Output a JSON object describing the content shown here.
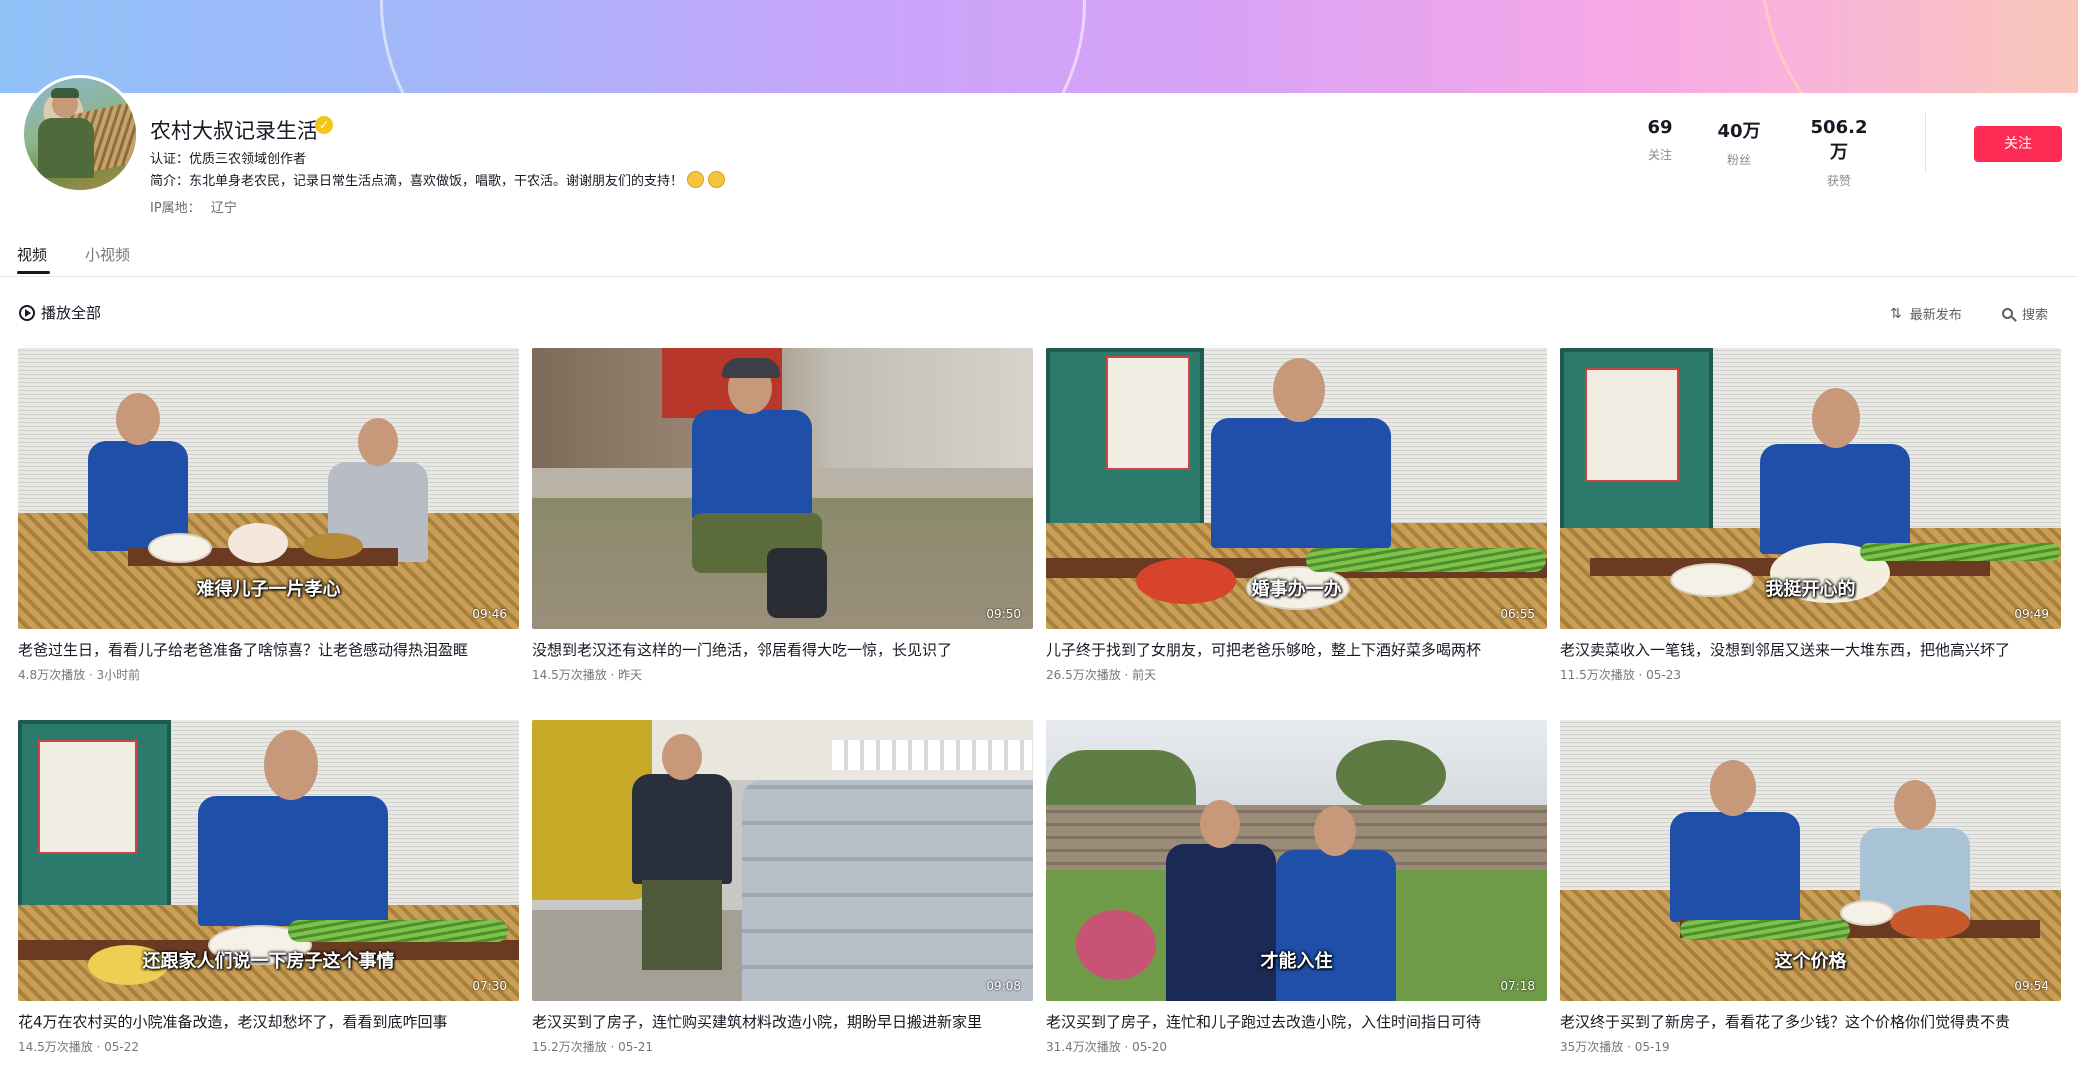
{
  "profile": {
    "name": "农村大叔记录生活",
    "verified_icon": "verified-badge-icon",
    "certification": "认证：优质三农领域创作者",
    "bio": "简介：东北单身老农民，记录日常生活点滴，喜欢做饭，唱歌，干农活。谢谢朋友们的支持！",
    "ip_label": "IP属地：",
    "ip_value": "辽宁",
    "stats": [
      {
        "value": "69",
        "label": "关注"
      },
      {
        "value": "40万",
        "label": "粉丝"
      },
      {
        "value": "506.2万",
        "label": "获赞"
      }
    ],
    "follow_label": "关注"
  },
  "tabs": [
    {
      "label": "视频",
      "active": true
    },
    {
      "label": "小视频",
      "active": false
    }
  ],
  "toolbar": {
    "play_all": "播放全部",
    "sort": "最新发布",
    "search": "搜索"
  },
  "videos": [
    {
      "caption": "难得儿子一片孝心",
      "duration": "09:46",
      "title": "老爸过生日，看看儿子给老爸准备了啥惊喜？让老爸感动得热泪盈眶",
      "meta": "4.8万次播放 · 3小时前"
    },
    {
      "caption": "",
      "duration": "09:50",
      "title": "没想到老汉还有这样的一门绝活，邻居看得大吃一惊，长见识了",
      "meta": "14.5万次播放 · 昨天"
    },
    {
      "caption": "婚事办一办",
      "duration": "06:55",
      "title": "儿子终于找到了女朋友，可把老爸乐够呛，整上下酒好菜多喝两杯",
      "meta": "26.5万次播放 · 前天"
    },
    {
      "caption": "我挺开心的",
      "duration": "09:49",
      "title": "老汉卖菜收入一笔钱，没想到邻居又送来一大堆东西，把他高兴坏了",
      "meta": "11.5万次播放 · 05-23"
    },
    {
      "caption": "还跟家人们说一下房子这个事情",
      "duration": "07:30",
      "title": "花4万在农村买的小院准备改造，老汉却愁坏了，看看到底咋回事",
      "meta": "14.5万次播放 · 05-22"
    },
    {
      "caption": "",
      "duration": "09:08",
      "title": "老汉买到了房子，连忙购买建筑材料改造小院，期盼早日搬进新家里",
      "meta": "15.2万次播放 · 05-21"
    },
    {
      "caption": "才能入住",
      "duration": "07:18",
      "title": "老汉买到了房子，连忙和儿子跑过去改造小院，入住时间指日可待",
      "meta": "31.4万次播放 · 05-20"
    },
    {
      "caption": "这个价格",
      "duration": "09:54",
      "title": "老汉终于买到了新房子，看看花了多少钱？这个价格你们觉得贵不贵",
      "meta": "35万次播放 · 05-19"
    }
  ],
  "colors": {
    "accent": "#fe2c55",
    "verified": "#f5c518",
    "text": "#161823",
    "muted": "#75767c"
  }
}
